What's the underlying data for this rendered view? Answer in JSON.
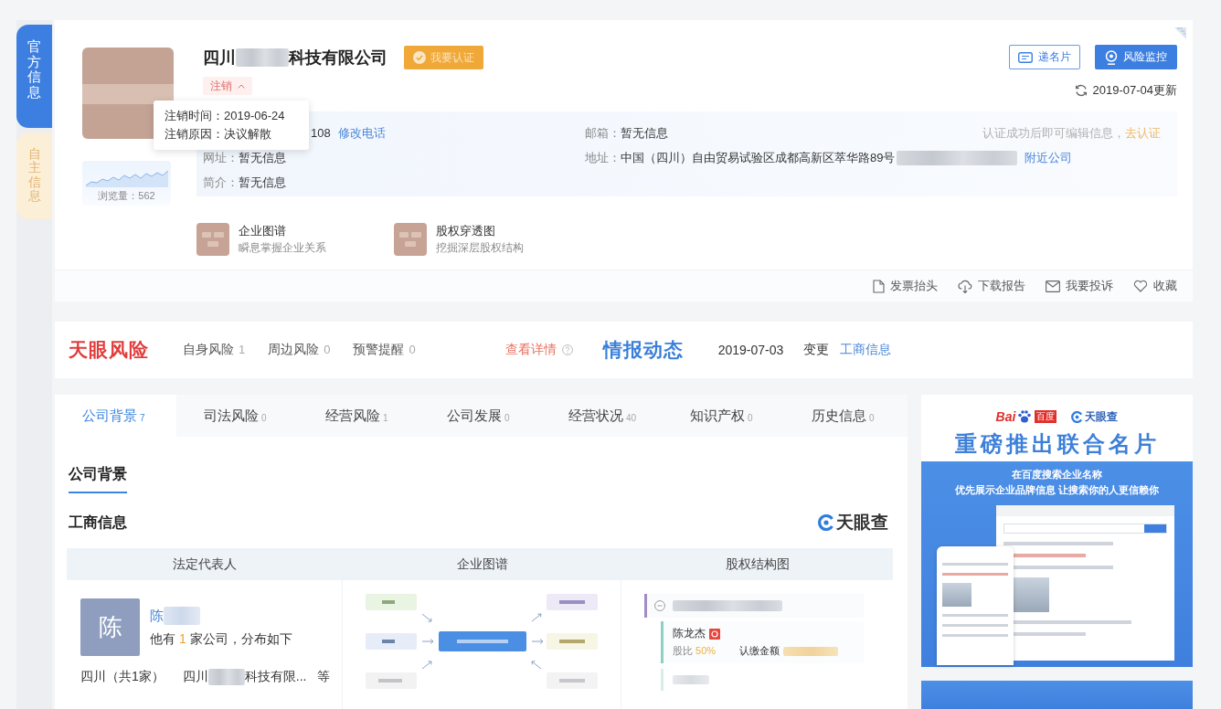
{
  "sidebar": {
    "tabs": [
      {
        "label": "官方信息",
        "selected": true
      },
      {
        "label": "自主信息",
        "selected": false
      }
    ]
  },
  "header": {
    "name": [
      {
        "kind": "text",
        "text": "四川"
      },
      {
        "kind": "redacted"
      },
      {
        "kind": "text",
        "text": "科技有限公司"
      }
    ],
    "verify_button": "我要认证",
    "status": {
      "label": "注销",
      "expanded": true
    },
    "tooltip": [
      "注销时间：2019-06-24",
      "注销原因：决议解散"
    ],
    "views": "浏览量：562",
    "buttons": [
      {
        "label": "递名片",
        "kind": "card"
      },
      {
        "label": "风险监控",
        "kind": "monitor"
      }
    ],
    "updated": "2019-07-04更新",
    "phone": {
      "value": "108",
      "link": "修改电话"
    },
    "website": {
      "label": "网址：",
      "value": "暂无信息"
    },
    "intro": {
      "label": "简介：",
      "value": "暂无信息"
    },
    "email": {
      "label": "邮箱：",
      "value": "暂无信息"
    },
    "address": {
      "label": "地址：",
      "value": [
        {
          "kind": "text",
          "text": "中国（四川）自由贸易试验区成都高新区萃华路89号"
        },
        {
          "kind": "redacted"
        }
      ],
      "link": "附近公司"
    },
    "verify_hint": {
      "text": "认证成功后即可编辑信息，",
      "link": "去认证"
    },
    "features": [
      {
        "title": "企业图谱",
        "subtitle": "瞬息掌握企业关系"
      },
      {
        "title": "股权穿透图",
        "subtitle": "挖掘深层股权结构"
      }
    ],
    "actions": [
      {
        "label": "发票抬头",
        "kind": "invoice"
      },
      {
        "label": "下载报告",
        "kind": "download"
      },
      {
        "label": "我要投诉",
        "kind": "complaint"
      },
      {
        "label": "收藏",
        "kind": "favorite"
      }
    ]
  },
  "risk_bar": {
    "logo": "天眼风险",
    "counts": [
      {
        "label": "自身风险",
        "count": "1"
      },
      {
        "label": "周边风险",
        "count": "0"
      },
      {
        "label": "预警提醒",
        "count": "0"
      }
    ],
    "details_link": "查看详情",
    "news_logo": "情报动态",
    "news_date": "2019-07-03",
    "news_type": "变更",
    "news_link": "工商信息"
  },
  "tabs": [
    {
      "label": "公司背景",
      "count": "7",
      "selected": true
    },
    {
      "label": "司法风险",
      "count": "0",
      "selected": false
    },
    {
      "label": "经营风险",
      "count": "1",
      "selected": false
    },
    {
      "label": "公司发展",
      "count": "0",
      "selected": false
    },
    {
      "label": "经营状况",
      "count": "40",
      "selected": false
    },
    {
      "label": "知识产权",
      "count": "0",
      "selected": false
    },
    {
      "label": "历史信息",
      "count": "0",
      "selected": false
    }
  ],
  "section": {
    "title": "公司背景",
    "subtitle": "工商信息",
    "brand": "天眼查",
    "columns": [
      "法定代表人",
      "企业图谱",
      "股权结构图"
    ],
    "legal_rep": {
      "avatar": "陈",
      "name": [
        {
          "kind": "text",
          "text": "陈"
        },
        {
          "kind": "redacted"
        }
      ],
      "summary": {
        "before": "他有 ",
        "count": "1",
        "after": " 家公司，分布如下"
      },
      "region": "四川（共1家）",
      "company": [
        {
          "kind": "text",
          "text": "四川"
        },
        {
          "kind": "redacted"
        },
        {
          "kind": "text",
          "text": "科技有限..."
        }
      ],
      "more": "等"
    },
    "equity": {
      "holder": "陈龙杰",
      "share_label": "股比",
      "share": "50%",
      "amount_label": "认缴金额"
    }
  },
  "ad": {
    "baidu_latin": "Bai",
    "baidu_cn": "百度",
    "partner": "天眼查",
    "headline": "重磅推出联合名片",
    "lines": [
      "在百度搜索企业名称",
      "优先展示企业品牌信息 让搜索你的人更信赖你"
    ]
  }
}
